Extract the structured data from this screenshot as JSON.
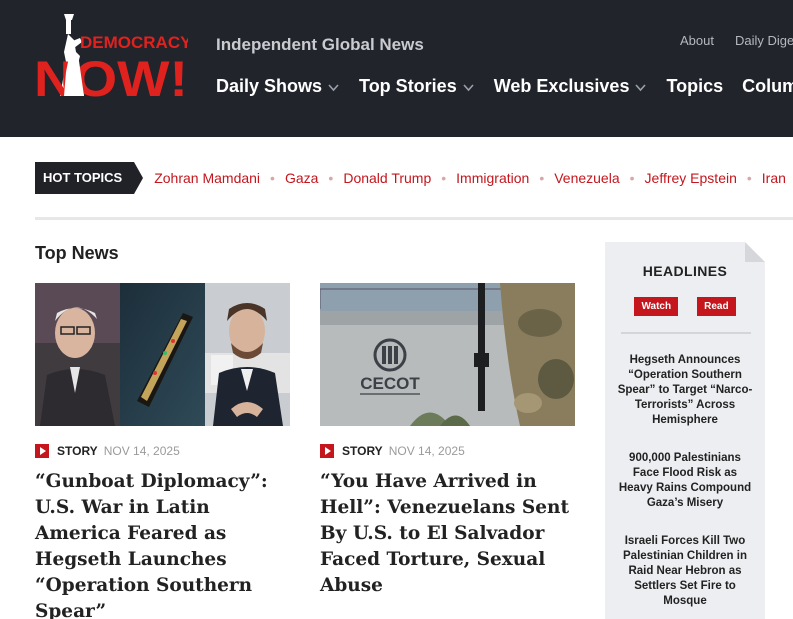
{
  "header": {
    "logo": {
      "top_text": "DEMOCRACY",
      "bottom_text": "NOW!"
    },
    "tagline": "Independent Global News",
    "utility_links": [
      "About",
      "Daily Dige"
    ],
    "nav": [
      {
        "label": "Daily Shows",
        "dropdown": true
      },
      {
        "label": "Top Stories",
        "dropdown": true
      },
      {
        "label": "Web Exclusives",
        "dropdown": true
      },
      {
        "label": "Topics",
        "dropdown": false
      },
      {
        "label": "Columns",
        "dropdown": false
      }
    ]
  },
  "hot_topics": {
    "label": "HOT TOPICS",
    "separator": "•",
    "links": [
      "Zohran Mamdani",
      "Gaza",
      "Donald Trump",
      "Immigration",
      "Venezuela",
      "Jeffrey Epstein",
      "Iran"
    ]
  },
  "top_news": {
    "title": "Top News",
    "cards": [
      {
        "type": "STORY",
        "date": "NOV 14, 2025",
        "headline": "“Gunboat Diplomacy”: U.S. War in Latin America Feared as Hegseth Launches “Operation Southern Spear”"
      },
      {
        "type": "STORY",
        "date": "NOV 14, 2025",
        "headline": "“You Have Arrived in Hell”: Venezuelans Sent By U.S. to El Salvador Faced Torture, Sexual Abuse",
        "image_sign": "CECOT"
      }
    ]
  },
  "headlines": {
    "title": "HEADLINES",
    "watch": "Watch",
    "read": "Read",
    "items": [
      "Hegseth Announces “Operation Southern Spear” to Target “Narco-Terrorists” Across Hemisphere",
      "900,000 Palestinians Face Flood Risk as Heavy Rains Compound Gaza’s Misery",
      "Israeli Forces Kill Two Palestinian Children in Raid Near Hebron as Settlers Set Fire to Mosque"
    ]
  },
  "colors": {
    "brand_red": "#c4161c",
    "header_bg": "#22242b",
    "sidebar_bg": "#eceef1"
  }
}
